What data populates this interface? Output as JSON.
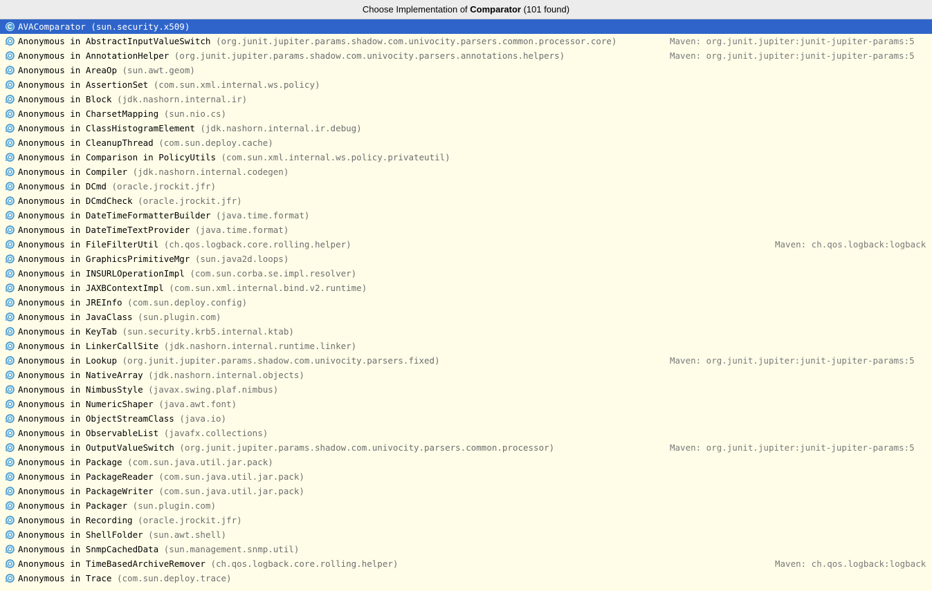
{
  "title": {
    "prefix": "Choose Implementation of ",
    "interface": "Comparator",
    "suffix": " (101 found)"
  },
  "colors": {
    "selection": "#2f65ca",
    "background": "#fffde8",
    "icon_ring": "#3e8fc8",
    "icon_fill": "#b9e3f2",
    "package_text": "#6e6e6e"
  },
  "items": [
    {
      "icon": "class-icon",
      "name": "AVAComparator",
      "package": "(sun.security.x509)",
      "location": "",
      "selected": true
    },
    {
      "icon": "anonymous-class-icon",
      "name": "Anonymous in AbstractInputValueSwitch",
      "package": "(org.junit.jupiter.params.shadow.com.univocity.parsers.common.processor.core)",
      "location": "Maven: org.junit.jupiter:junit-jupiter-params:5"
    },
    {
      "icon": "anonymous-class-icon",
      "name": "Anonymous in AnnotationHelper",
      "package": "(org.junit.jupiter.params.shadow.com.univocity.parsers.annotations.helpers)",
      "location": "Maven: org.junit.jupiter:junit-jupiter-params:5"
    },
    {
      "icon": "anonymous-class-icon",
      "name": "Anonymous in AreaOp",
      "package": "(sun.awt.geom)",
      "location": ""
    },
    {
      "icon": "anonymous-class-icon",
      "name": "Anonymous in AssertionSet",
      "package": "(com.sun.xml.internal.ws.policy)",
      "location": ""
    },
    {
      "icon": "anonymous-class-icon",
      "name": "Anonymous in Block",
      "package": "(jdk.nashorn.internal.ir)",
      "location": ""
    },
    {
      "icon": "anonymous-class-icon",
      "name": "Anonymous in CharsetMapping",
      "package": "(sun.nio.cs)",
      "location": ""
    },
    {
      "icon": "anonymous-class-icon",
      "name": "Anonymous in ClassHistogramElement",
      "package": "(jdk.nashorn.internal.ir.debug)",
      "location": ""
    },
    {
      "icon": "anonymous-class-icon",
      "name": "Anonymous in CleanupThread",
      "package": "(com.sun.deploy.cache)",
      "location": ""
    },
    {
      "icon": "anonymous-class-icon",
      "name": "Anonymous in Comparison in PolicyUtils",
      "package": "(com.sun.xml.internal.ws.policy.privateutil)",
      "location": ""
    },
    {
      "icon": "anonymous-class-icon",
      "name": "Anonymous in Compiler",
      "package": "(jdk.nashorn.internal.codegen)",
      "location": ""
    },
    {
      "icon": "anonymous-class-icon",
      "name": "Anonymous in DCmd",
      "package": "(oracle.jrockit.jfr)",
      "location": ""
    },
    {
      "icon": "anonymous-class-icon",
      "name": "Anonymous in DCmdCheck",
      "package": "(oracle.jrockit.jfr)",
      "location": ""
    },
    {
      "icon": "anonymous-class-icon",
      "name": "Anonymous in DateTimeFormatterBuilder",
      "package": "(java.time.format)",
      "location": ""
    },
    {
      "icon": "anonymous-class-icon",
      "name": "Anonymous in DateTimeTextProvider",
      "package": "(java.time.format)",
      "location": ""
    },
    {
      "icon": "anonymous-class-icon",
      "name": "Anonymous in FileFilterUtil",
      "package": "(ch.qos.logback.core.rolling.helper)",
      "location": "Maven: ch.qos.logback:logback"
    },
    {
      "icon": "anonymous-class-icon",
      "name": "Anonymous in GraphicsPrimitiveMgr",
      "package": "(sun.java2d.loops)",
      "location": ""
    },
    {
      "icon": "anonymous-class-icon",
      "name": "Anonymous in INSURLOperationImpl",
      "package": "(com.sun.corba.se.impl.resolver)",
      "location": ""
    },
    {
      "icon": "anonymous-class-icon",
      "name": "Anonymous in JAXBContextImpl",
      "package": "(com.sun.xml.internal.bind.v2.runtime)",
      "location": ""
    },
    {
      "icon": "anonymous-class-icon",
      "name": "Anonymous in JREInfo",
      "package": "(com.sun.deploy.config)",
      "location": ""
    },
    {
      "icon": "anonymous-class-icon",
      "name": "Anonymous in JavaClass",
      "package": "(sun.plugin.com)",
      "location": ""
    },
    {
      "icon": "anonymous-class-icon",
      "name": "Anonymous in KeyTab",
      "package": "(sun.security.krb5.internal.ktab)",
      "location": ""
    },
    {
      "icon": "anonymous-class-icon",
      "name": "Anonymous in LinkerCallSite",
      "package": "(jdk.nashorn.internal.runtime.linker)",
      "location": ""
    },
    {
      "icon": "anonymous-class-icon",
      "name": "Anonymous in Lookup",
      "package": "(org.junit.jupiter.params.shadow.com.univocity.parsers.fixed)",
      "location": "Maven: org.junit.jupiter:junit-jupiter-params:5"
    },
    {
      "icon": "anonymous-class-icon",
      "name": "Anonymous in NativeArray",
      "package": "(jdk.nashorn.internal.objects)",
      "location": ""
    },
    {
      "icon": "anonymous-class-icon",
      "name": "Anonymous in NimbusStyle",
      "package": "(javax.swing.plaf.nimbus)",
      "location": ""
    },
    {
      "icon": "anonymous-class-icon",
      "name": "Anonymous in NumericShaper",
      "package": "(java.awt.font)",
      "location": ""
    },
    {
      "icon": "anonymous-class-icon",
      "name": "Anonymous in ObjectStreamClass",
      "package": "(java.io)",
      "location": ""
    },
    {
      "icon": "anonymous-class-icon",
      "name": "Anonymous in ObservableList",
      "package": "(javafx.collections)",
      "location": ""
    },
    {
      "icon": "anonymous-class-icon",
      "name": "Anonymous in OutputValueSwitch",
      "package": "(org.junit.jupiter.params.shadow.com.univocity.parsers.common.processor)",
      "location": "Maven: org.junit.jupiter:junit-jupiter-params:5"
    },
    {
      "icon": "anonymous-class-icon",
      "name": "Anonymous in Package",
      "package": "(com.sun.java.util.jar.pack)",
      "location": ""
    },
    {
      "icon": "anonymous-class-icon",
      "name": "Anonymous in PackageReader",
      "package": "(com.sun.java.util.jar.pack)",
      "location": ""
    },
    {
      "icon": "anonymous-class-icon",
      "name": "Anonymous in PackageWriter",
      "package": "(com.sun.java.util.jar.pack)",
      "location": ""
    },
    {
      "icon": "anonymous-class-icon",
      "name": "Anonymous in Packager",
      "package": "(sun.plugin.com)",
      "location": ""
    },
    {
      "icon": "anonymous-class-icon",
      "name": "Anonymous in Recording",
      "package": "(oracle.jrockit.jfr)",
      "location": ""
    },
    {
      "icon": "anonymous-class-icon",
      "name": "Anonymous in ShellFolder",
      "package": "(sun.awt.shell)",
      "location": ""
    },
    {
      "icon": "anonymous-class-icon",
      "name": "Anonymous in SnmpCachedData",
      "package": "(sun.management.snmp.util)",
      "location": ""
    },
    {
      "icon": "anonymous-class-icon",
      "name": "Anonymous in TimeBasedArchiveRemover",
      "package": "(ch.qos.logback.core.rolling.helper)",
      "location": "Maven: ch.qos.logback:logback"
    },
    {
      "icon": "anonymous-class-icon",
      "name": "Anonymous in Trace",
      "package": "(com.sun.deploy.trace)",
      "location": ""
    }
  ]
}
